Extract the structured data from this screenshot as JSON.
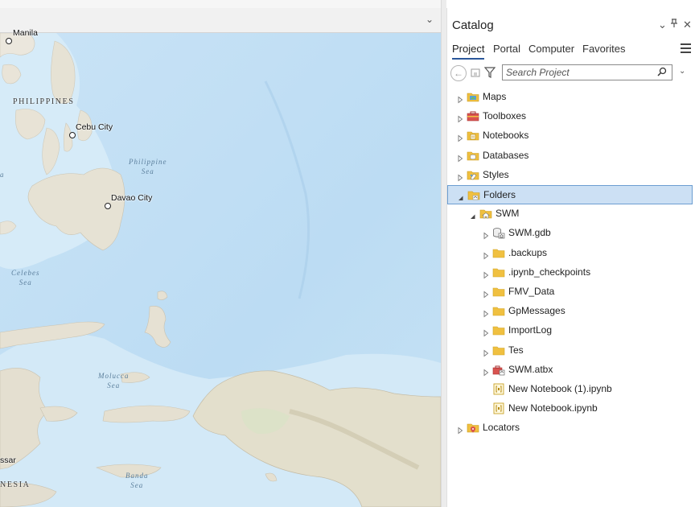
{
  "map": {
    "labels": {
      "manila": "Manila",
      "philippines": "PHILIPPINES",
      "cebu": "Cebu City",
      "philippine_sea_1": "Philippine",
      "philippine_sea_2": "Sea",
      "davao": "Davao City",
      "celebes_1": "Celebes",
      "celebes_2": "Sea",
      "molucca_1": "Molucca",
      "molucca_2": "Sea",
      "banda_1": "Banda",
      "banda_2": "Sea",
      "makassar_fragment": "ssar",
      "indonesia_fragment": "NESIA",
      "left_edge_fragment": "a"
    },
    "tab_dropdown_icon": "chevron-down-icon"
  },
  "catalog": {
    "title": "Catalog",
    "header_buttons": {
      "options": "⌄",
      "pin": "⊓",
      "close": "✕"
    },
    "tabs": [
      {
        "label": "Project",
        "active": true
      },
      {
        "label": "Portal",
        "active": false
      },
      {
        "label": "Computer",
        "active": false
      },
      {
        "label": "Favorites",
        "active": false
      }
    ],
    "search": {
      "placeholder": "Search Project"
    },
    "tree": [
      {
        "label": "Maps",
        "icon": "maps-folder-icon",
        "level": 0,
        "expanded": false
      },
      {
        "label": "Toolboxes",
        "icon": "toolbox-icon",
        "level": 0,
        "expanded": false
      },
      {
        "label": "Notebooks",
        "icon": "notebooks-folder-icon",
        "level": 0,
        "expanded": false
      },
      {
        "label": "Databases",
        "icon": "databases-folder-icon",
        "level": 0,
        "expanded": false
      },
      {
        "label": "Styles",
        "icon": "styles-folder-icon",
        "level": 0,
        "expanded": false
      },
      {
        "label": "Folders",
        "icon": "folders-icon",
        "level": 0,
        "expanded": true,
        "selected": true
      },
      {
        "label": "SWM",
        "icon": "home-folder-icon",
        "level": 1,
        "expanded": true
      },
      {
        "label": "SWM.gdb",
        "icon": "geodatabase-icon",
        "level": 2,
        "expanded": false
      },
      {
        "label": ".backups",
        "icon": "folder-icon",
        "level": 2,
        "expanded": false
      },
      {
        "label": ".ipynb_checkpoints",
        "icon": "folder-icon",
        "level": 2,
        "expanded": false
      },
      {
        "label": "FMV_Data",
        "icon": "folder-icon",
        "level": 2,
        "expanded": false
      },
      {
        "label": "GpMessages",
        "icon": "folder-icon",
        "level": 2,
        "expanded": false
      },
      {
        "label": "ImportLog",
        "icon": "folder-icon",
        "level": 2,
        "expanded": false
      },
      {
        "label": "Tes",
        "icon": "folder-icon",
        "level": 2,
        "expanded": false
      },
      {
        "label": "SWM.atbx",
        "icon": "atbx-toolbox-icon",
        "level": 2,
        "expanded": false
      },
      {
        "label": "New Notebook (1).ipynb",
        "icon": "notebook-file-icon",
        "level": 2,
        "leaf": true
      },
      {
        "label": "New Notebook.ipynb",
        "icon": "notebook-file-icon",
        "level": 2,
        "leaf": true
      },
      {
        "label": "Locators",
        "icon": "locators-icon",
        "level": 0,
        "expanded": false
      }
    ]
  },
  "colors": {
    "accent": "#2b579a",
    "selection_fill": "#cce0f4",
    "selection_border": "#6c9dd1",
    "folder_yellow": "#f0c040",
    "ocean": "#bfdcf2",
    "land": "#e9e6dc"
  }
}
